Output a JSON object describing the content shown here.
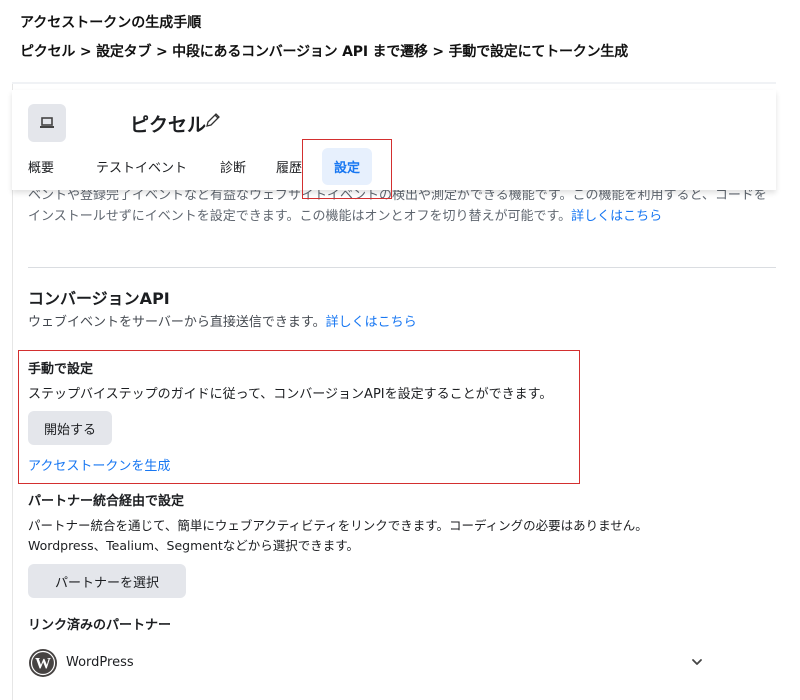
{
  "doc": {
    "title": "アクセストークンの生成手順",
    "path": "ピクセル > 設定タブ > 中段にあるコンバージョン API まで遷移 > 手動で設定にてトークン生成"
  },
  "header": {
    "name": "ピクセル",
    "tabs": [
      "概要",
      "テストイベント",
      "診断",
      "履歴",
      "設定"
    ],
    "active_tab": "設定"
  },
  "faded_text": {
    "text": "ベントや登録完了イベントなど有益なウェブサイトイベントの検出や測定ができる機能です。この機能を利用すると、コードをインストールせずにイベントを設定できます。この機能はオンとオフを切り替えが可能です。",
    "link": "詳しくはこちら"
  },
  "capi": {
    "title": "コンバージョンAPI",
    "desc": "ウェブイベントをサーバーから直接送信できます。",
    "link": "詳しくはこちら"
  },
  "manual": {
    "title": "手動で設定",
    "desc": "ステップバイステップのガイドに従って、コンバージョンAPIを設定することができます。",
    "start_button": "開始する",
    "generate_link": "アクセストークンを生成"
  },
  "partner": {
    "title": "パートナー統合経由で設定",
    "desc1": "パートナー統合を通じて、簡単にウェブアクティビティをリンクできます。コーディングの必要はありません。",
    "desc2": "Wordpress、Tealium、Segmentなどから選択できます。",
    "button": "パートナーを選択"
  },
  "linked": {
    "title": "リンク済みのパートナー",
    "partner_name": "WordPress"
  },
  "icons": {
    "app": "laptop-icon",
    "edit": "pencil-icon",
    "wp": "wordpress-logo",
    "expand": "chevron-down-icon"
  },
  "colors": {
    "link": "#1877f2",
    "highlight_border": "#d32f2f",
    "active_tab_bg": "#e7f0fd"
  }
}
